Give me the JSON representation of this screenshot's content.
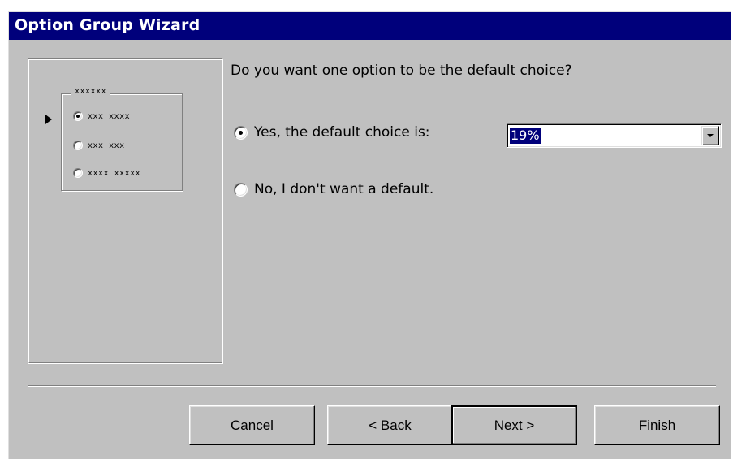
{
  "window": {
    "title": "Option Group Wizard"
  },
  "preview": {
    "frame_label": "xxxxxx",
    "options": [
      {
        "label": "xxx xxxx",
        "selected": true
      },
      {
        "label": "xxx xxx",
        "selected": false
      },
      {
        "label": "xxxx xxxxx",
        "selected": false
      }
    ]
  },
  "question": "Do you want one option to be the default choice?",
  "options": {
    "yes_label": "Yes, the default choice is:",
    "yes_selected": true,
    "no_label": "No, I don't want a default.",
    "no_selected": false
  },
  "default_combo": {
    "value": "19%"
  },
  "buttons": {
    "cancel": "Cancel",
    "back_prefix": "< ",
    "back_mnemonic": "B",
    "back_rest": "ack",
    "next_mnemonic": "N",
    "next_rest": "ext >",
    "finish_mnemonic": "F",
    "finish_rest": "inish"
  },
  "colors": {
    "titlebar": "#00007b",
    "face": "#c0c0c0",
    "selection": "#00007b"
  }
}
